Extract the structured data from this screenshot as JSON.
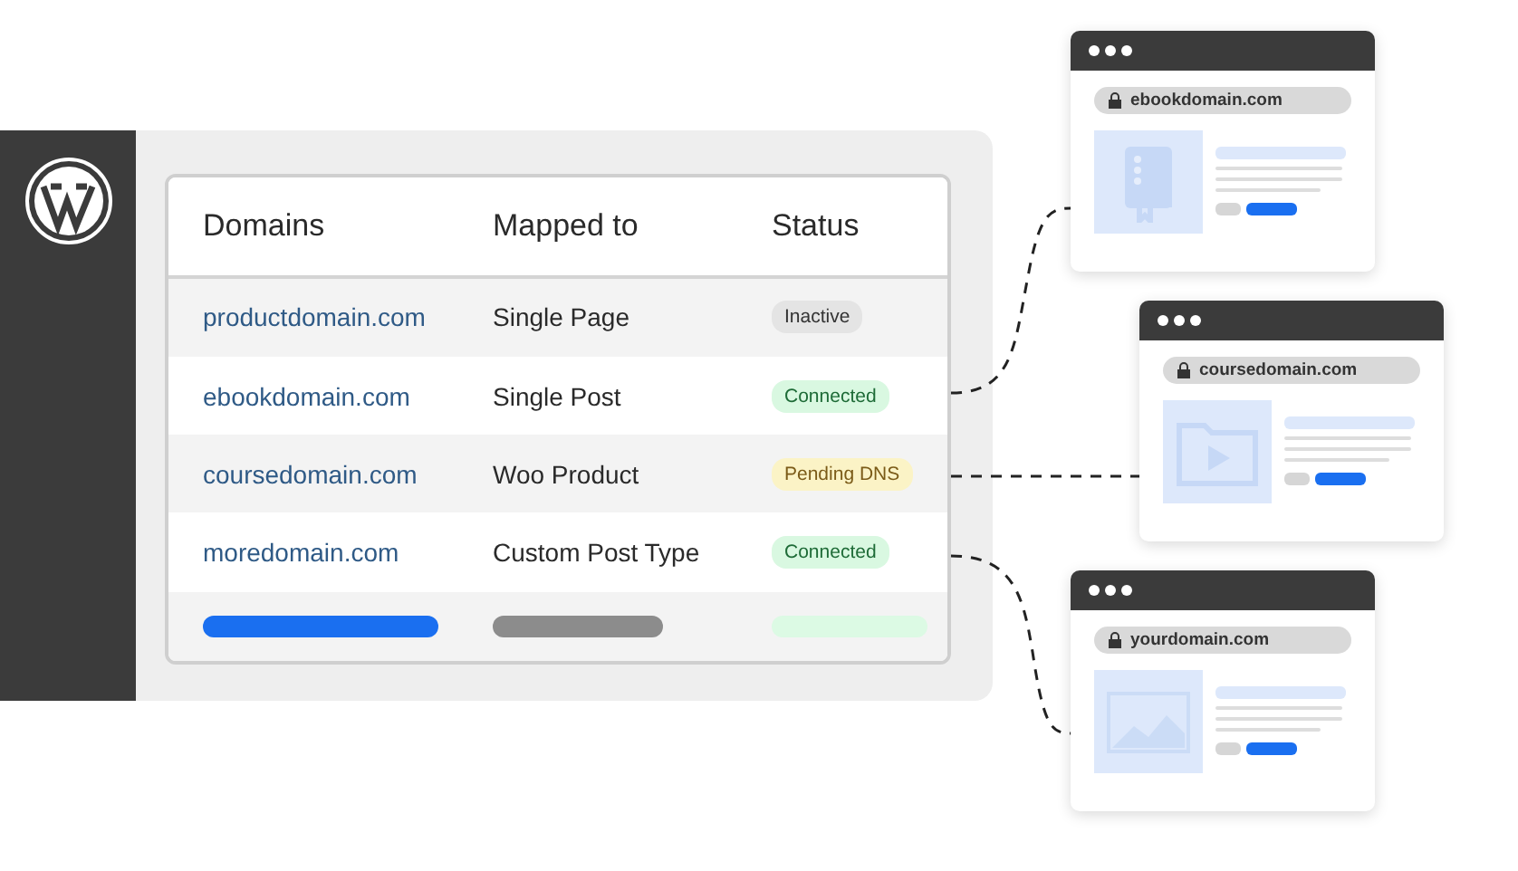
{
  "table": {
    "columns": [
      "Domains",
      "Mapped to",
      "Status"
    ],
    "rows": [
      {
        "domain": "productdomain.com",
        "mapped_to": "Single Page",
        "status": {
          "label": "Inactive",
          "kind": "inactive"
        }
      },
      {
        "domain": "ebookdomain.com",
        "mapped_to": "Single Post",
        "status": {
          "label": "Connected",
          "kind": "connected"
        }
      },
      {
        "domain": "coursedomain.com",
        "mapped_to": "Woo Product",
        "status": {
          "label": "Pending DNS",
          "kind": "pending"
        }
      },
      {
        "domain": "moredomain.com",
        "mapped_to": "Custom Post Type",
        "status": {
          "label": "Connected",
          "kind": "connected"
        }
      }
    ]
  },
  "browsers": [
    {
      "url": "ebookdomain.com",
      "kind": "book"
    },
    {
      "url": "coursedomain.com",
      "kind": "video"
    },
    {
      "url": "yourdomain.com",
      "kind": "image"
    }
  ]
}
